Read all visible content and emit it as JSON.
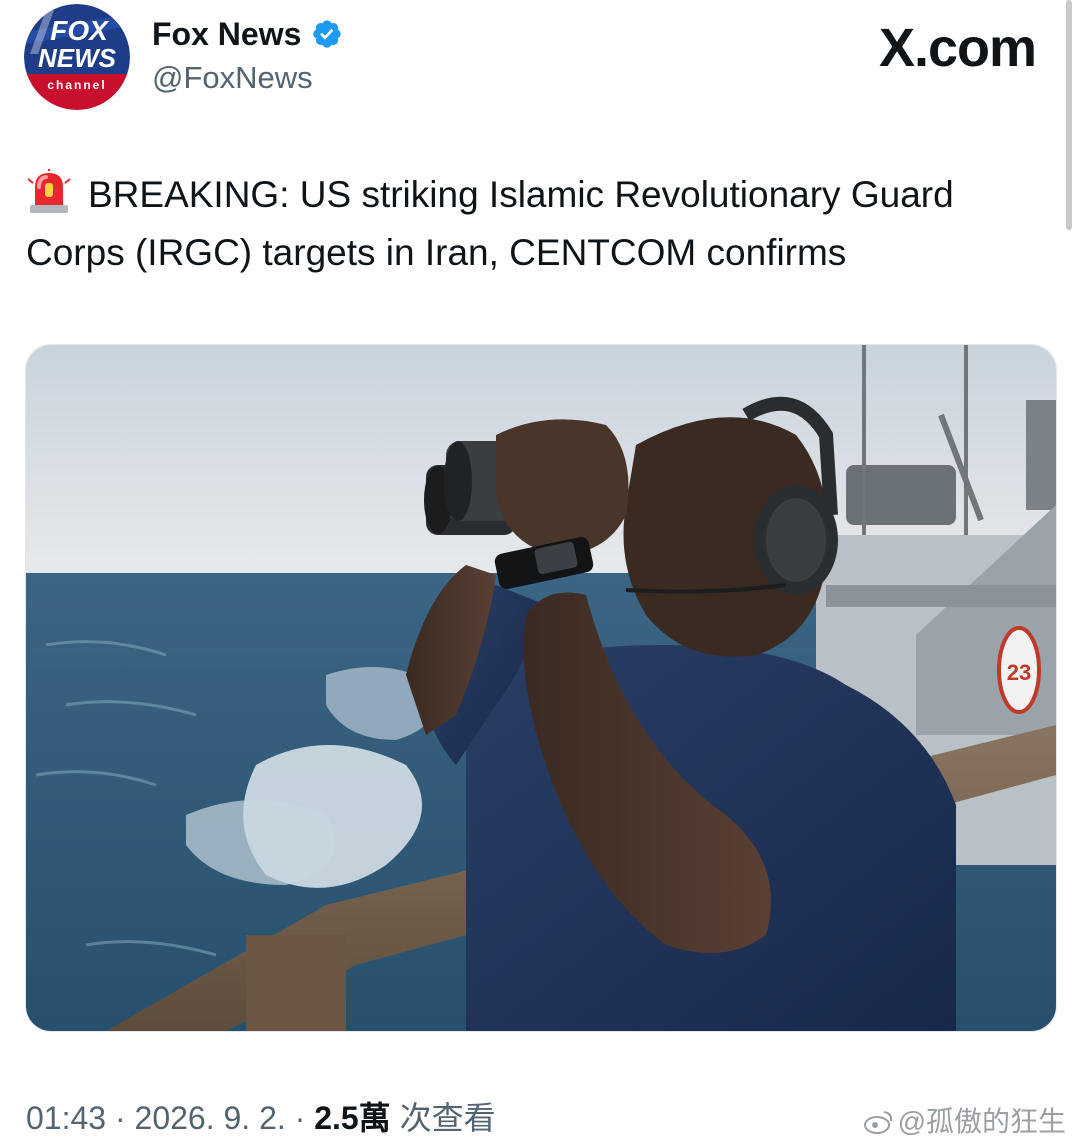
{
  "author": {
    "display_name": "Fox News",
    "handle": "@FoxNews",
    "verified": true,
    "avatar": "fox-news-channel-logo"
  },
  "site_mark": "X.com",
  "tweet": {
    "emoji": "rotating-light-icon",
    "text": "BREAKING: US striking Islamic Revolutionary Guard Corps (IRGC) targets in Iran, CENTCOM confirms",
    "media_description": "Sailor in navy uniform and headset looking through binoculars over the ocean from a ship deck",
    "time": "01:43",
    "date": "2026. 9. 2.",
    "separator": "·",
    "views_count": "2.5萬",
    "views_label": "次查看"
  },
  "watermark": {
    "text": "@孤傲的狂生"
  },
  "colors": {
    "text_primary": "#0f1419",
    "text_secondary": "#536471",
    "verified_blue": "#1d9bf0",
    "fox_red": "#c8102e",
    "fox_blue": "#1f3c88"
  }
}
